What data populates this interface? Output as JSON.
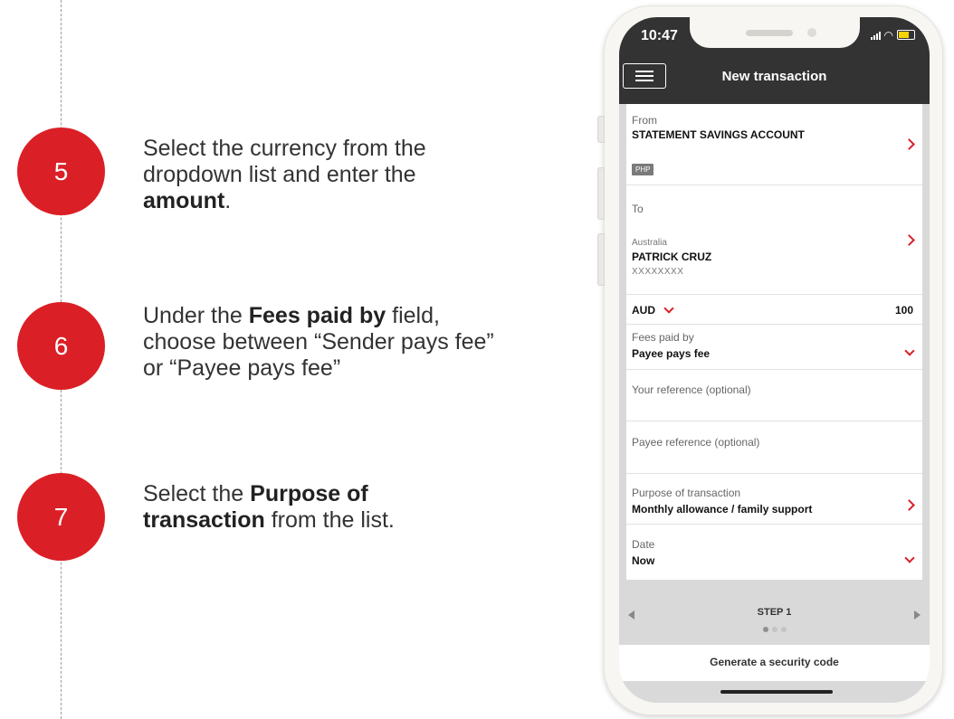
{
  "instructions": [
    {
      "number": "5",
      "pre": "Select the currency from the dropdown list and enter the ",
      "bold": "amount",
      "post": "."
    },
    {
      "number": "6",
      "pre": "Under the ",
      "bold": "Fees paid by",
      "post": " field, choose between “Sender pays fee” or “Payee pays fee”"
    },
    {
      "number": "7",
      "pre": "Select the ",
      "bold": "Purpose of transaction",
      "post": " from the list."
    }
  ],
  "status_bar": {
    "time": "10:47"
  },
  "header": {
    "title": "New transaction"
  },
  "form": {
    "from": {
      "label": "From",
      "account": "STATEMENT SAVINGS ACCOUNT",
      "badge": "PHP"
    },
    "to": {
      "label": "To",
      "country": "Australia",
      "payee": "PATRICK CRUZ",
      "account_masked": "XXXXXXXX"
    },
    "currency": {
      "value": "AUD",
      "amount": "100"
    },
    "fees": {
      "label": "Fees paid by",
      "value": "Payee pays fee"
    },
    "your_reference": {
      "placeholder": "Your reference (optional)"
    },
    "payee_reference": {
      "placeholder": "Payee reference (optional)"
    },
    "purpose": {
      "label": "Purpose of transaction",
      "value": "Monthly allowance / family support"
    },
    "date": {
      "label": "Date",
      "value": "Now"
    }
  },
  "stepper": {
    "label": "STEP 1",
    "total_steps": 3,
    "active_step": 1
  },
  "security_button": {
    "label": "Generate a security code"
  },
  "colors": {
    "accent": "#db1f26",
    "header_bg": "#333333"
  }
}
